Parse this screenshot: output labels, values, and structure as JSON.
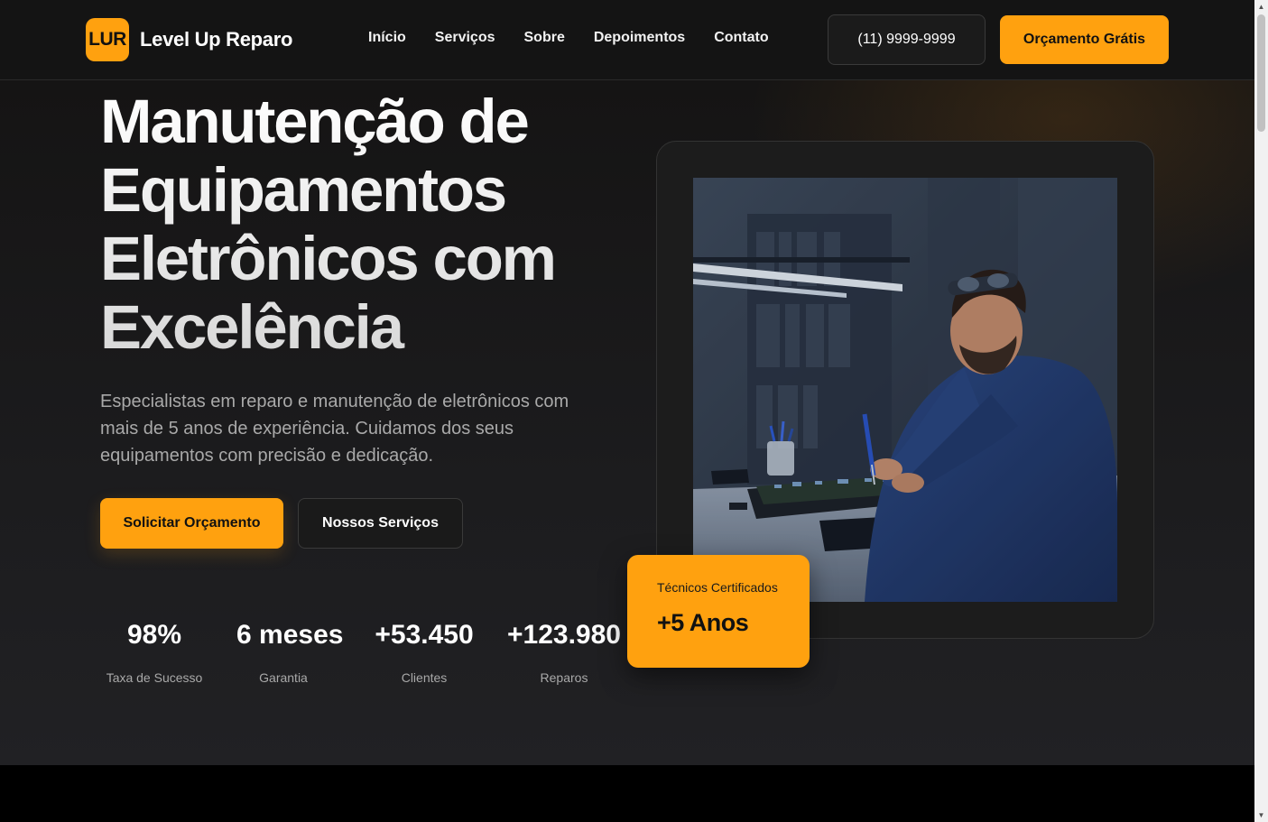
{
  "nav": {
    "logo_text": "LUR",
    "brand_name": "Level Up Reparo",
    "links": [
      "Início",
      "Serviços",
      "Sobre",
      "Depoimentos",
      "Contato"
    ],
    "phone_label": "(11) 9999-9999",
    "cta_label": "Orçamento Grátis"
  },
  "hero": {
    "title_lines": [
      "Manutenção de",
      "Equipamentos",
      "Eletrônicos com",
      "Excelência"
    ],
    "subtitle": "Especialistas em reparo e manutenção de eletrônicos com mais de 5 anos de experiência. Cuidamos dos seus equipamentos com precisão e dedicação.",
    "primary_button": "Solicitar Orçamento",
    "secondary_button": "Nossos Serviços",
    "stats": [
      {
        "value": "98%",
        "label": "Taxa de Sucesso"
      },
      {
        "value": "6 meses",
        "label": "Garantia"
      },
      {
        "value": "+53.450",
        "label": "Clientes"
      },
      {
        "value": "+123.980",
        "label": "Reparos"
      }
    ],
    "badge": {
      "label": "Técnicos Certificados",
      "value": "+5 Anos"
    }
  },
  "colors": {
    "accent": "#ffa10f",
    "nav_bg": "#141414",
    "hero_bg": "#1c1c1e"
  }
}
